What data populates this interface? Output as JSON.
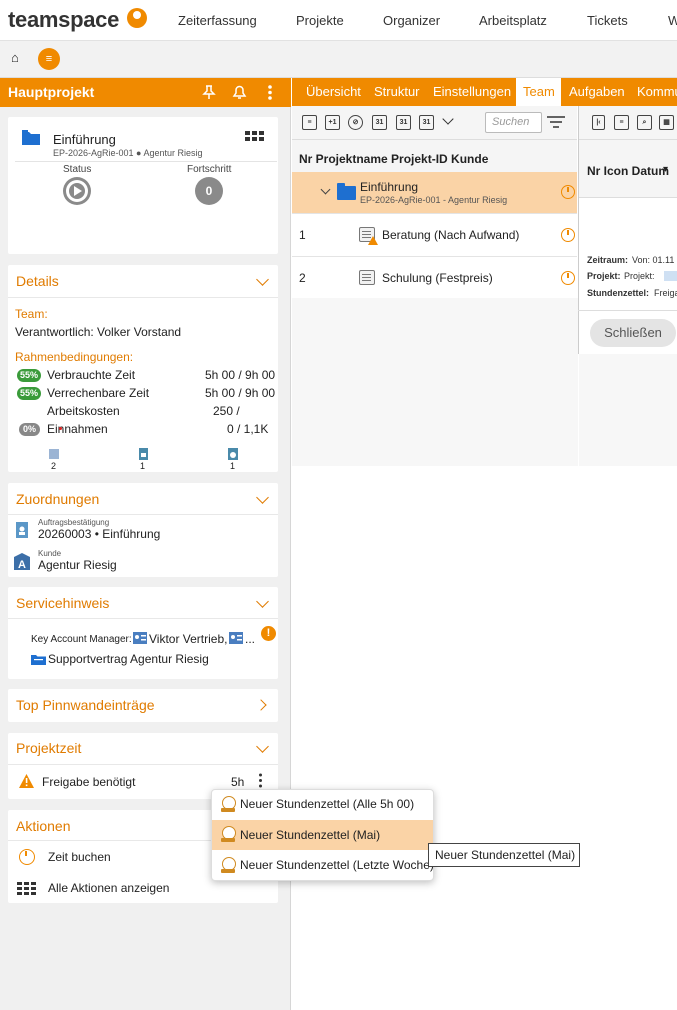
{
  "topnav": {
    "logo": "teamspace",
    "items": [
      "Zeiterfassung",
      "Projekte",
      "Organizer",
      "Arbeitsplatz",
      "Tickets",
      "W"
    ]
  },
  "subbar": {
    "menu_glyph": "≡"
  },
  "leftpanel": {
    "title": "Hauptprojekt",
    "project": {
      "name": "Einführung",
      "sub": "EP-2026-AgRie-001 ● Agentur Riesig",
      "status_label": "Status",
      "progress_label": "Fortschritt",
      "progress_value": "0"
    },
    "details": {
      "title": "Details",
      "team_label": "Team:",
      "responsible": "Verantwortlich: Volker Vorstand",
      "conditions_label": "Rahmenbedingungen:",
      "rows": [
        {
          "pill": "55%",
          "label": "Verbrauchte Zeit",
          "value": "5h 00 /  9h 00"
        },
        {
          "pill": "55%",
          "label": "Verrechenbare Zeit",
          "value": "5h 00 /  9h 00"
        },
        {
          "pill": "",
          "label": "Arbeitskosten",
          "value": "250 /"
        },
        {
          "pill": "0%",
          "label": "Einnahmen",
          "value": "0 /    1,1K"
        }
      ],
      "counts": [
        "2",
        "1",
        "1"
      ]
    },
    "assignments": {
      "title": "Zuordnungen",
      "items": [
        {
          "caption": "Auftragsbestätigung",
          "value": "20260003 • Einführung"
        },
        {
          "caption": "Kunde",
          "value": "Agentur Riesig"
        }
      ]
    },
    "service": {
      "title": "Servicehinweis",
      "kam_label": "Key Account Manager:",
      "kam_value": "Viktor Vertrieb,",
      "kam_more": "...",
      "contract": "Supportvertrag Agentur Riesig"
    },
    "pinboard": {
      "title": "Top Pinnwandeinträge"
    },
    "projecttime": {
      "title": "Projektzeit",
      "item": "Freigabe benötigt",
      "value": "5h"
    },
    "actions": {
      "title": "Aktionen",
      "items": [
        "Zeit buchen",
        "Alle Aktionen anzeigen"
      ]
    }
  },
  "tabs": [
    "Übersicht",
    "Struktur",
    "Einstellungen",
    "Team",
    "Aufgaben",
    "Kommu"
  ],
  "active_tab": "Team",
  "search_placeholder": "Suchen",
  "toolbar_labels": {
    "plus1": "+1",
    "cal1": "31",
    "cal2": "31",
    "cal3": "31"
  },
  "grid": {
    "header": "Nr Projektname Projekt-ID Kunde",
    "main_row": {
      "name": "Einführung",
      "sub": "EP-2026-AgRie-001 - Agentur Riesig"
    },
    "rows": [
      {
        "nr": "1",
        "name": "Beratung (Nach Aufwand)"
      },
      {
        "nr": "2",
        "name": "Schulung (Festpreis)"
      }
    ]
  },
  "rightpane": {
    "header": "Nr Icon Datum",
    "header_arrow": "▾",
    "zeitraum_label": "Zeitraum:",
    "zeitraum_value": "Von: 01.11",
    "projekt_label": "Projekt:",
    "projekt_value": "Projekt:",
    "stundenzettel_label": "Stundenzettel:",
    "stundenzettel_value": "Freiga",
    "close_label": "Schließen"
  },
  "popup": {
    "items": [
      "Neuer Stundenzettel (Alle 5h 00)",
      "Neuer Stundenzettel (Mai)",
      "Neuer Stundenzettel (Letzte Woche)"
    ],
    "tooltip": "Neuer Stundenzettel (Mai)"
  },
  "colors": {
    "accent": "#f08a00",
    "highlight": "#fad3a6",
    "pill_green": "#3a9b3a",
    "pill_gray": "#888888"
  }
}
